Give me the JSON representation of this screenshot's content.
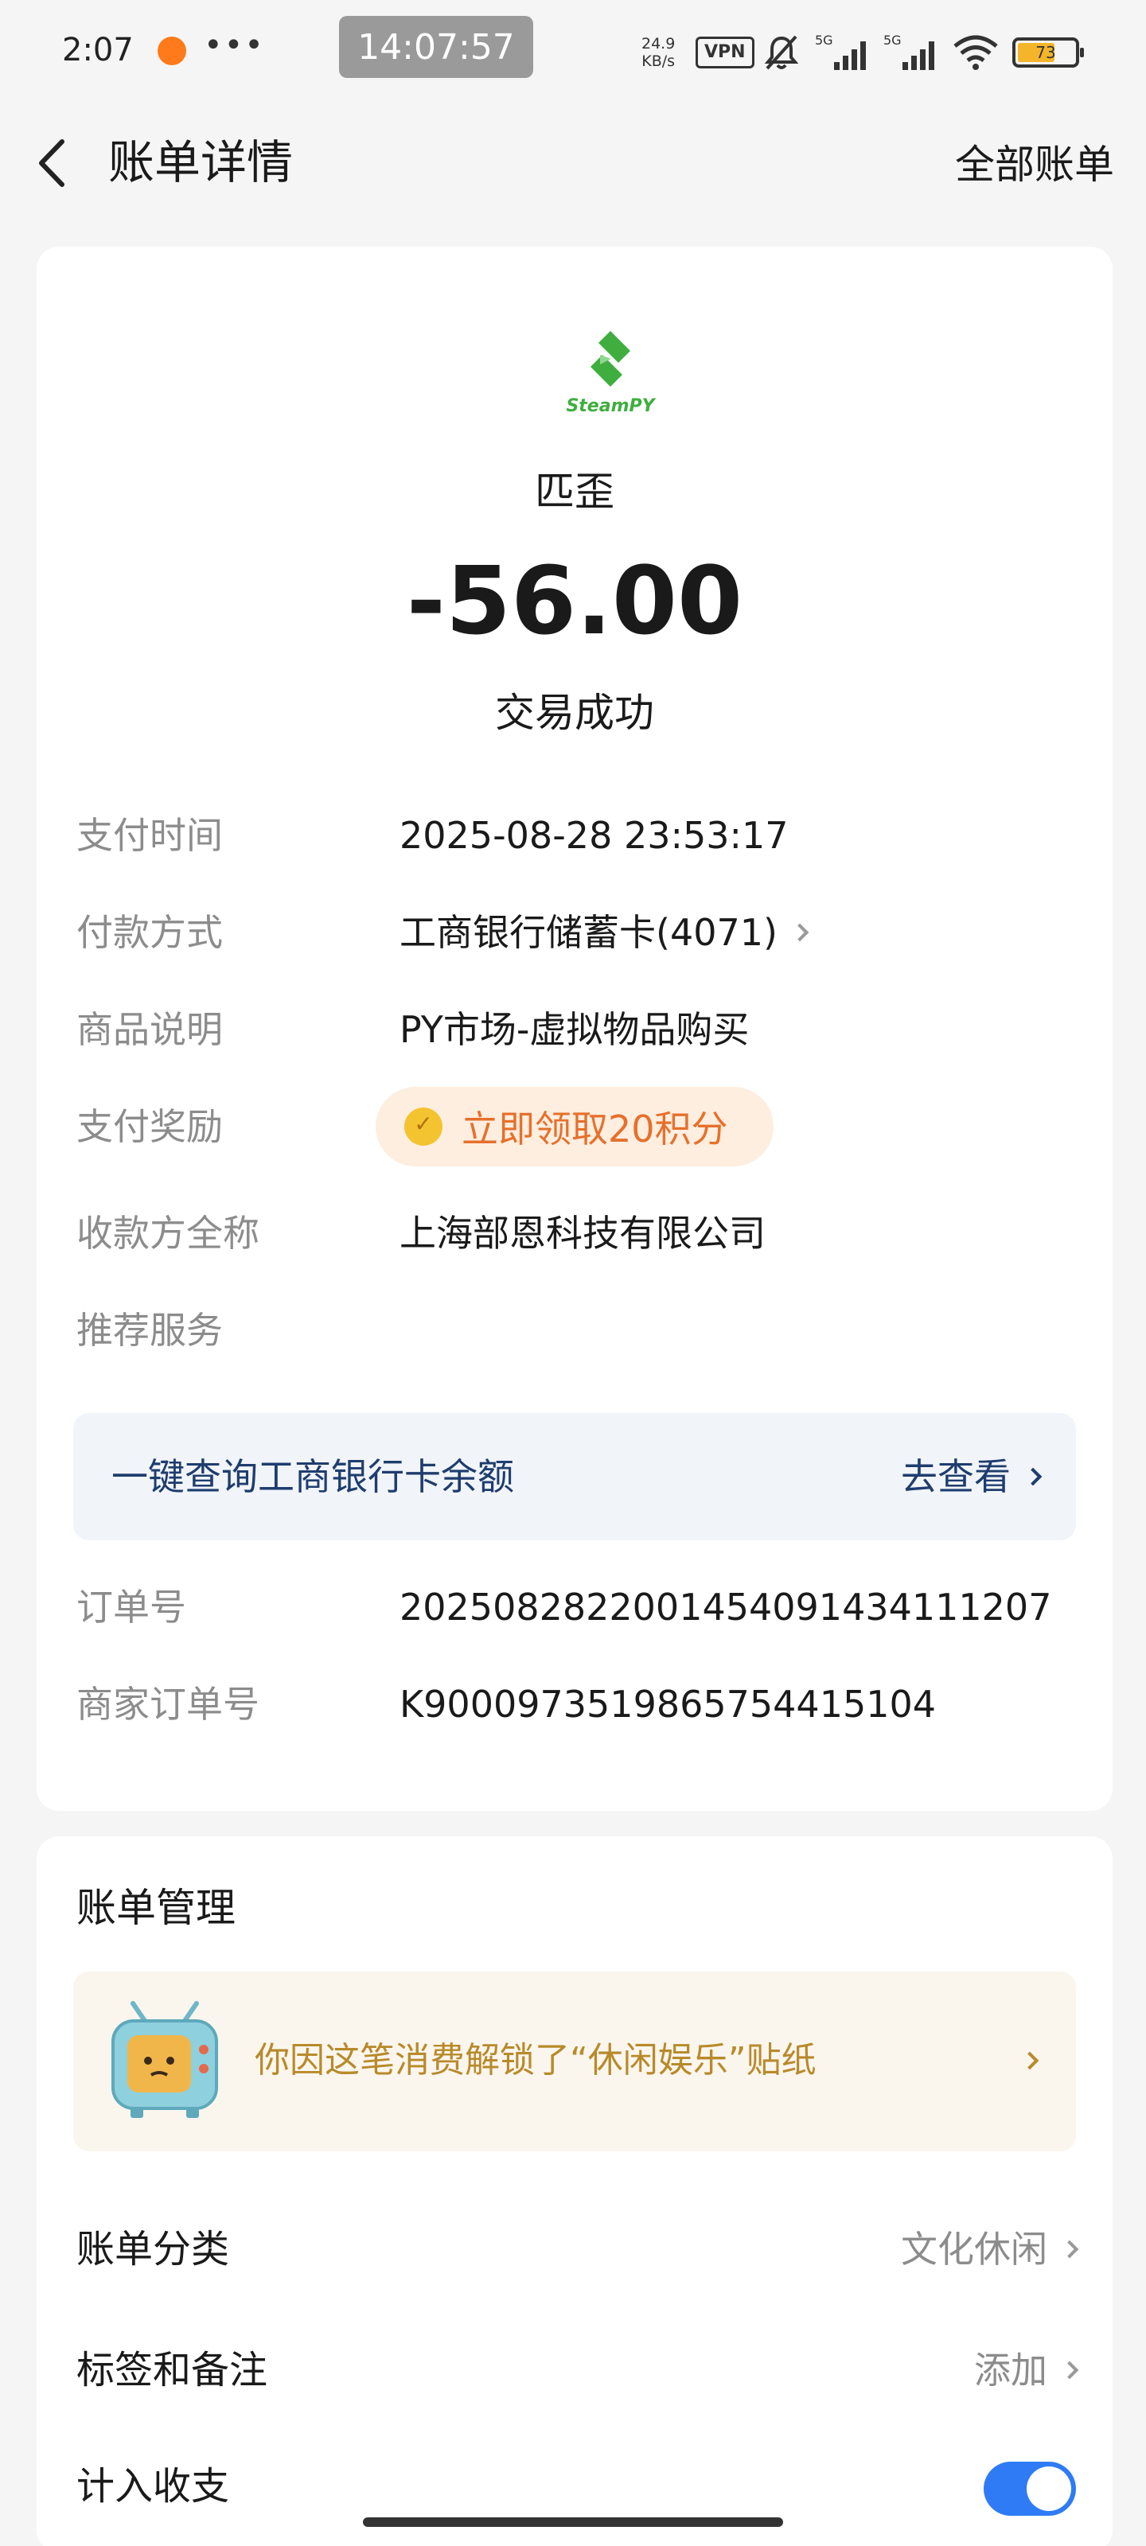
{
  "status_bar": {
    "time": "2:07",
    "more": "•••",
    "clock": "14:07:57",
    "speed_value": "24.9",
    "speed_unit": "KB/s",
    "vpn": "VPN",
    "battery": "73"
  },
  "header": {
    "title": "账单详情",
    "all_bills": "全部账单"
  },
  "bill": {
    "merchant_logo_text": "SteamPY",
    "merchant": "匹歪",
    "amount": "-56.00",
    "status": "交易成功",
    "fields": [
      {
        "label": "支付时间",
        "value": "2025-08-28 23:53:17"
      },
      {
        "label": "付款方式",
        "value": "工商银行储蓄卡(4071)"
      },
      {
        "label": "商品说明",
        "value": "PY市场-虚拟物品购买"
      },
      {
        "label": "支付奖励",
        "value": "立即领取20积分"
      },
      {
        "label": "收款方全称",
        "value": "上海部恩科技有限公司"
      },
      {
        "label": "推荐服务",
        "value": ""
      },
      {
        "label": "订单号",
        "value": "2025082822001454091434111207"
      },
      {
        "label": "商家订单号",
        "value": "K900097351986575441510­4"
      }
    ],
    "service": {
      "title": "一键查询工商银行卡余额",
      "action": "去查看"
    }
  },
  "management": {
    "title": "账单管理",
    "sticker_text": "你因这笔消费解锁了“休闲娱乐”贴纸",
    "category_label": "账单分类",
    "category_value": "文化休闲",
    "tags_label": "标签和备注",
    "tags_value": "添加",
    "include_label": "计入收支",
    "include_on": true
  },
  "colors": {
    "accent_blue": "#2f7bf5",
    "reward_orange": "#e6702b",
    "logo_green": "#3fae3f"
  }
}
